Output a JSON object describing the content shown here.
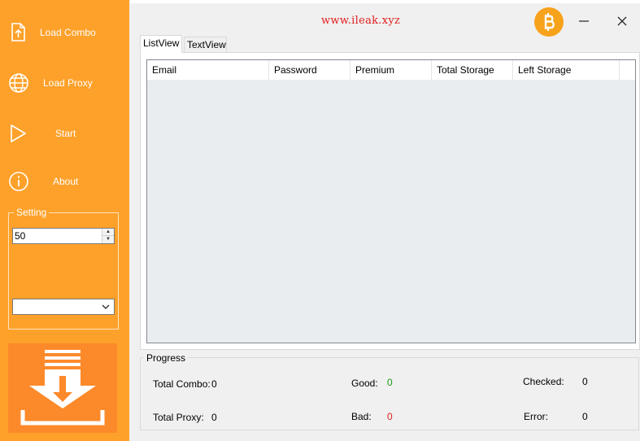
{
  "sidebar": {
    "items": [
      {
        "label": "Load Combo",
        "icon": "upload-file-icon"
      },
      {
        "label": "Load Proxy",
        "icon": "globe-icon"
      },
      {
        "label": "Start",
        "icon": "play-icon"
      },
      {
        "label": "About",
        "icon": "info-icon"
      }
    ],
    "setting": {
      "legend": "Setting",
      "threads_value": "50",
      "dropdown_value": ""
    },
    "download_icon": "download-icon"
  },
  "header": {
    "title": "www.ileak.xyz",
    "bitcoin_icon": "bitcoin-icon",
    "minimize_symbol": "—",
    "close_symbol": "✕"
  },
  "tabs": [
    {
      "label": "ListView",
      "active": true
    },
    {
      "label": "TextView",
      "active": false
    }
  ],
  "listview": {
    "columns": [
      "Email",
      "Password",
      "Premium",
      "Total Storage",
      "Left Storage"
    ],
    "rows": []
  },
  "progress": {
    "legend": "Progress",
    "total_combo_label": "Total Combo:",
    "total_combo_value": "0",
    "total_proxy_label": "Total Proxy:",
    "total_proxy_value": "0",
    "good_label": "Good:",
    "good_value": "0",
    "bad_label": "Bad:",
    "bad_value": "0",
    "checked_label": "Checked:",
    "checked_value": "0",
    "error_label": "Error:",
    "error_value": "0"
  },
  "colors": {
    "sidebar": "#fea12a",
    "accent_red": "#e11c1c",
    "good_green": "#1a9a1a",
    "bad_red": "#e11c1c",
    "bitcoin": "#f7a21b"
  }
}
